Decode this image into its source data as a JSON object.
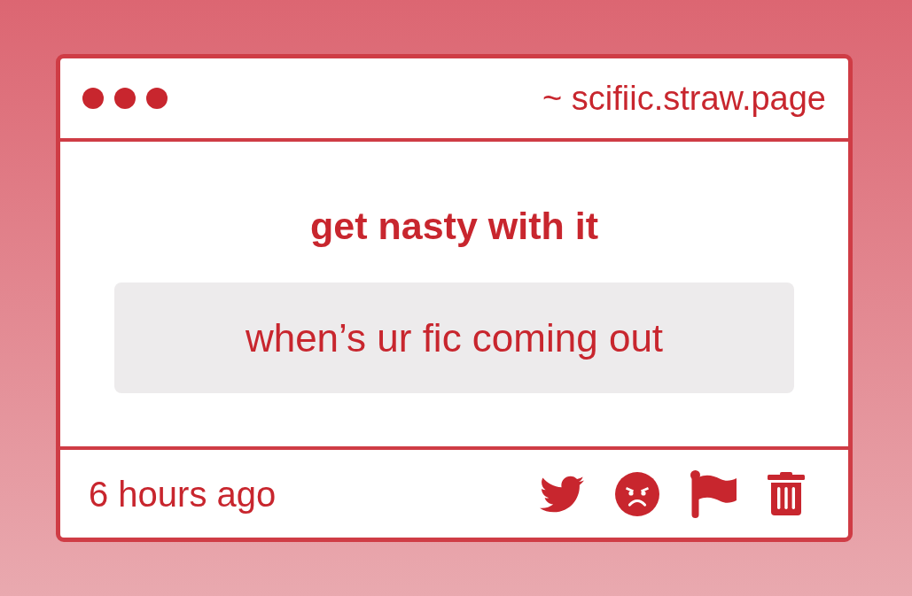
{
  "window": {
    "address": "~ scifiic.straw.page"
  },
  "prompt": {
    "title": "get nasty with it"
  },
  "question": {
    "text": "when’s ur fic coming out"
  },
  "footer": {
    "time": "6 hours ago",
    "actions": [
      {
        "kind": "bird"
      },
      {
        "kind": "angry-face"
      },
      {
        "kind": "flag"
      },
      {
        "kind": "trash"
      }
    ]
  }
}
